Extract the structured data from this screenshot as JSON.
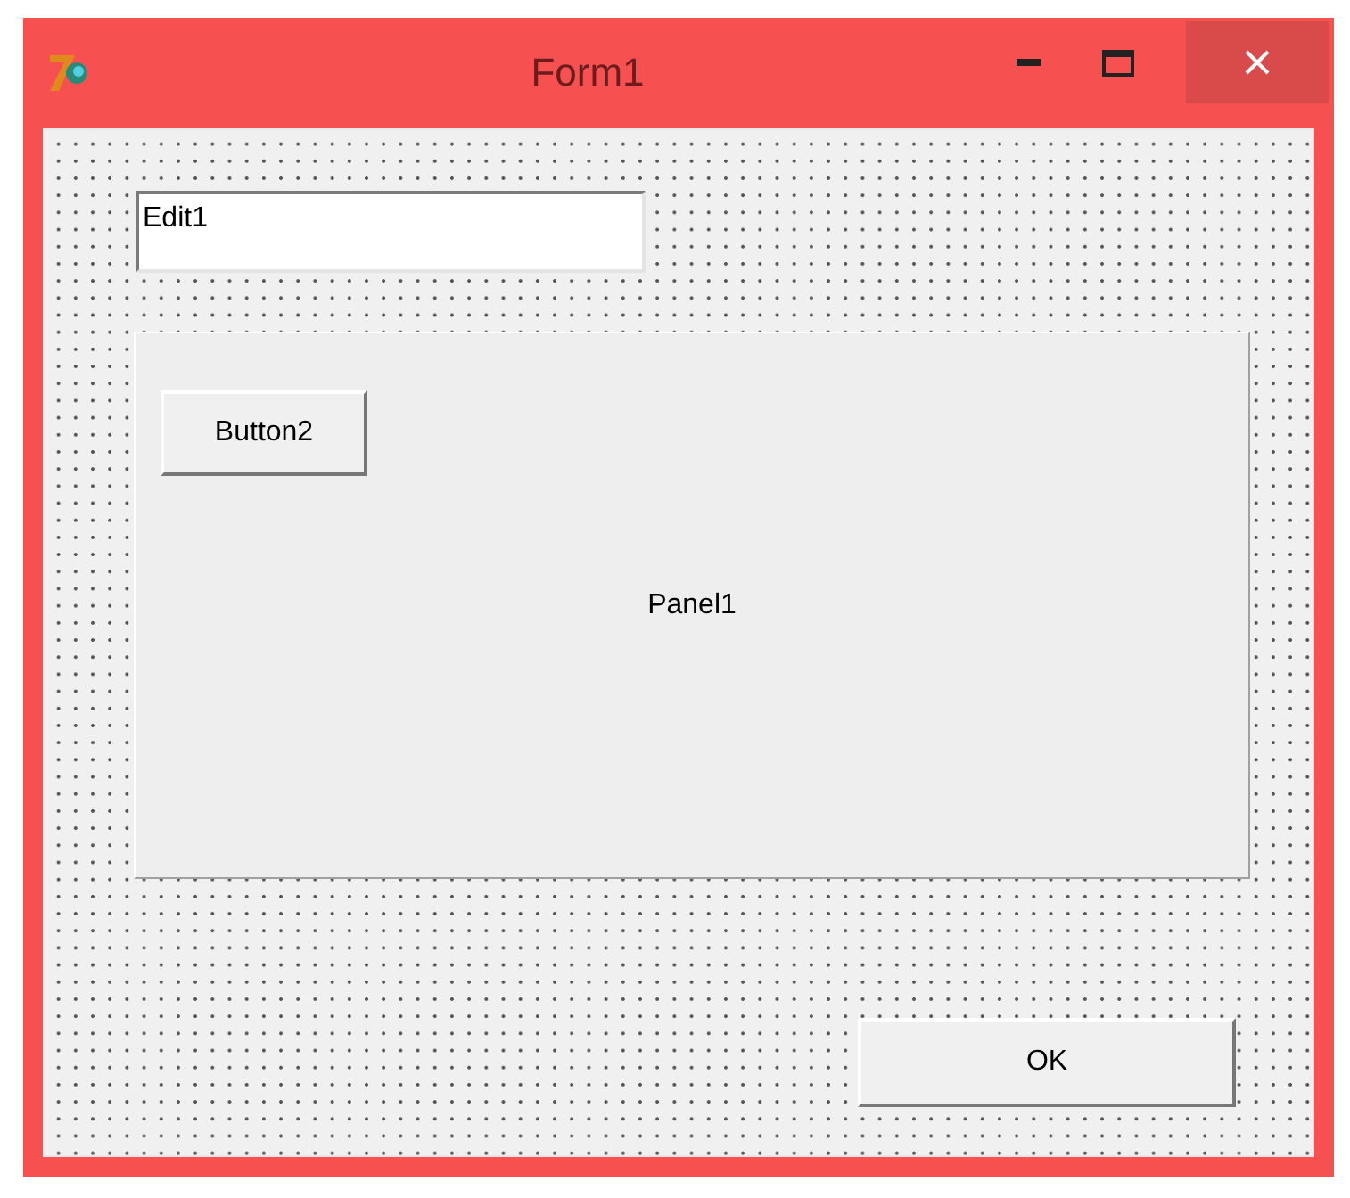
{
  "window": {
    "title": "Form1"
  },
  "edit": {
    "value": "Edit1"
  },
  "panel": {
    "caption": "Panel1",
    "buttons": [
      "Button2"
    ]
  },
  "buttons": [
    "OK"
  ]
}
